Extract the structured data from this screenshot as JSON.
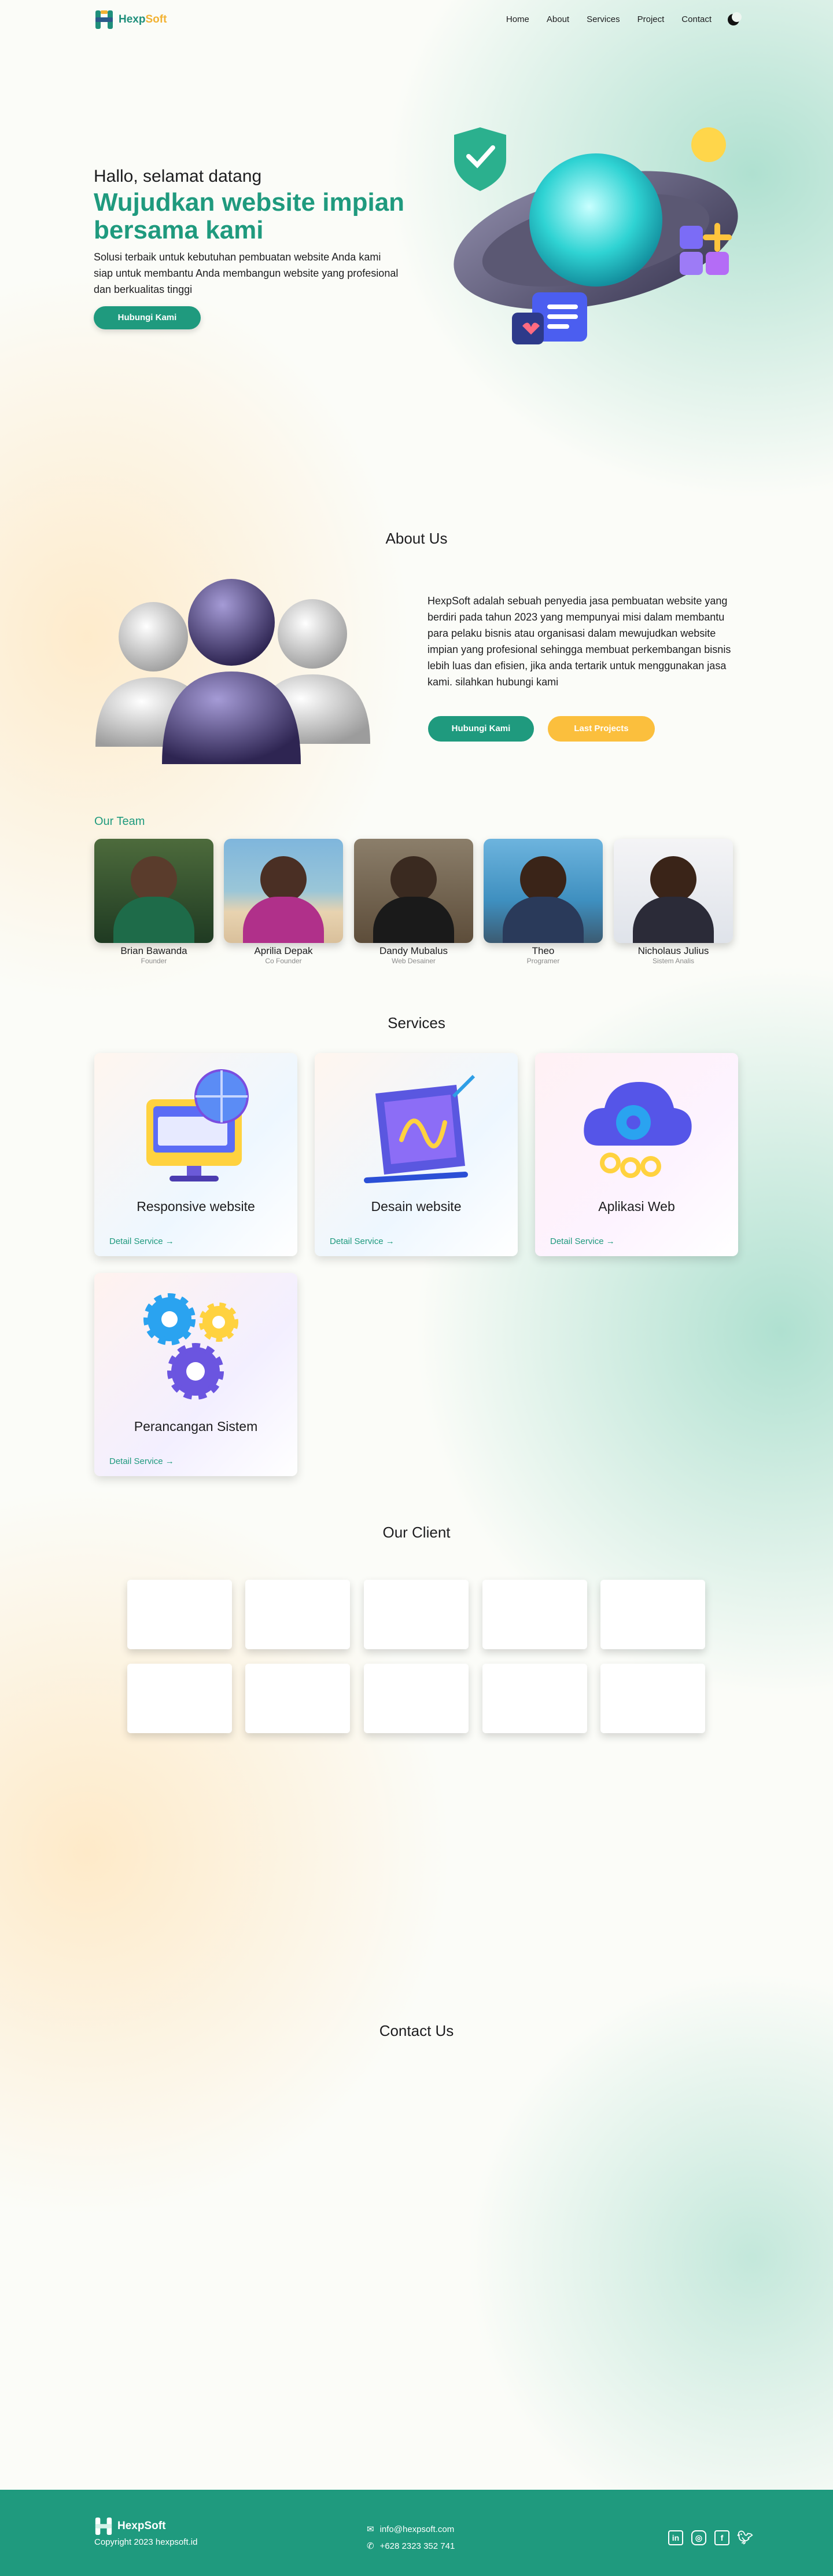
{
  "brand": {
    "name_part1": "Hexp",
    "name_part2": "Soft"
  },
  "nav": {
    "items": [
      "Home",
      "About",
      "Services",
      "Project",
      "Contact"
    ]
  },
  "hero": {
    "greeting": "Hallo, selamat datang",
    "title": "Wujudkan website impian bersama kami",
    "description": "Solusi terbaik untuk kebutuhan pembuatan website Anda kami siap untuk membantu Anda membangun website yang profesional dan berkualitas tinggi",
    "cta": "Hubungi Kami"
  },
  "about": {
    "title": "About Us",
    "text": "HexpSoft adalah sebuah penyedia jasa pembuatan website yang berdiri pada tahun 2023 yang mempunyai misi dalam membantu para pelaku bisnis atau organisasi dalam mewujudkan website impian yang profesional sehingga membuat perkembangan bisnis lebih luas dan efisien, jika anda tertarik untuk menggunakan jasa kami. silahkan hubungi kami",
    "btn_contact": "Hubungi Kami",
    "btn_projects": "Last Projects"
  },
  "team": {
    "title": "Our Team",
    "members": [
      {
        "name": "Brian Bawanda",
        "role": "Founder"
      },
      {
        "name": "Aprilia Depak",
        "role": "Co Founder"
      },
      {
        "name": "Dandy Mubalus",
        "role": "Web Desainer"
      },
      {
        "name": "Theo",
        "role": "Programer"
      },
      {
        "name": "Nicholaus Julius",
        "role": "Sistem Analis"
      }
    ]
  },
  "services": {
    "title": "Services",
    "items": [
      {
        "title": "Responsive website",
        "link": "Detail Service"
      },
      {
        "title": "Desain website",
        "link": "Detail Service"
      },
      {
        "title": "Aplikasi Web",
        "link": "Detail Service"
      },
      {
        "title": "Perancangan Sistem",
        "link": "Detail Service"
      }
    ]
  },
  "clients": {
    "title": "Our Client"
  },
  "contact": {
    "title": "Contact Us"
  },
  "footer": {
    "brand": "HexpSoft",
    "copyright": "Copyright 2023 hexpsoft.id",
    "email": "info@hexpsoft.com",
    "phone": "+628 2323 352 741",
    "social_icons": [
      "linkedin-icon",
      "instagram-icon",
      "facebook-icon",
      "twitter-icon"
    ]
  },
  "colors": {
    "primary": "#1f9a7e",
    "accent": "#fbbf3d"
  }
}
